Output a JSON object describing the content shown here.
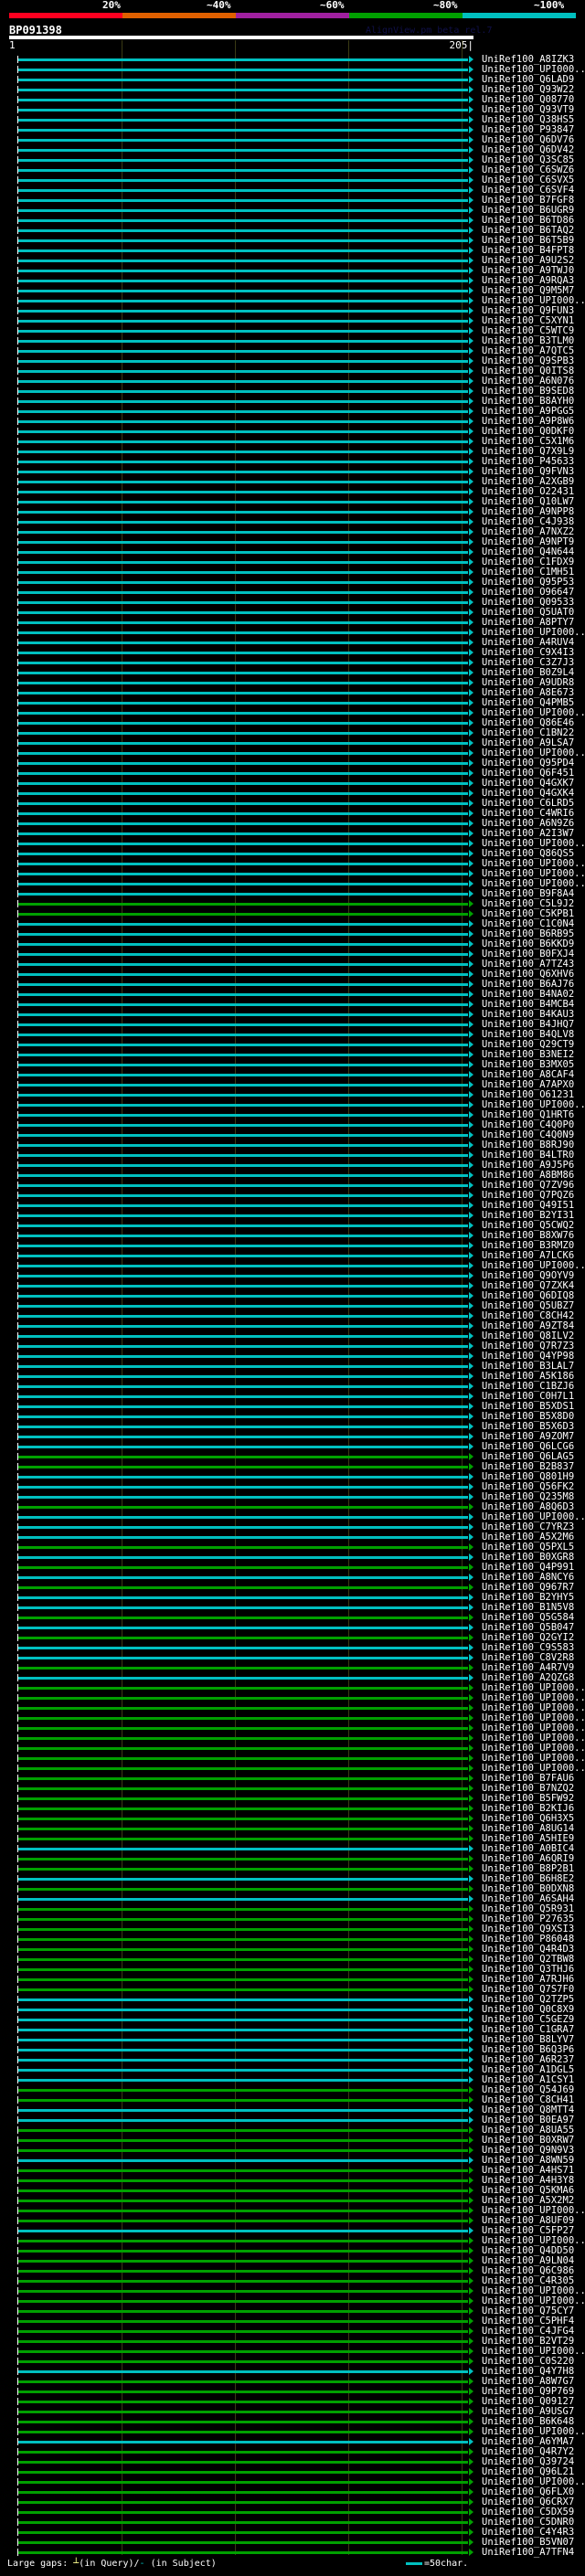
{
  "scale": {
    "labels": [
      "20%",
      "~40%",
      "~60%",
      "~80%",
      "~100%"
    ],
    "colors": [
      "#ff0020",
      "#e06000",
      "#a020a0",
      "#00a000",
      "#00c0c0"
    ]
  },
  "query": {
    "title": "BP091398",
    "start": "1",
    "end": "205|",
    "credit": "AlignView.pm beta rel.7"
  },
  "colors": {
    "c": "#00c0c0",
    "g": "#00a000"
  },
  "rows": [
    [
      "UniRef100_A8IZK3",
      "c"
    ],
    [
      "UniRef100_UPI000..",
      "c"
    ],
    [
      "UniRef100_Q6LAD9",
      "c"
    ],
    [
      "UniRef100_Q93W22",
      "c"
    ],
    [
      "UniRef100_Q08770",
      "c"
    ],
    [
      "UniRef100_Q93VT9",
      "c"
    ],
    [
      "UniRef100_Q38HS5",
      "c"
    ],
    [
      "UniRef100_P93847",
      "c"
    ],
    [
      "UniRef100_Q6DV76",
      "c"
    ],
    [
      "UniRef100_Q6DV42",
      "c"
    ],
    [
      "UniRef100_Q3SC85",
      "c"
    ],
    [
      "UniRef100_C6SWZ6",
      "c"
    ],
    [
      "UniRef100_C6SVX5",
      "c"
    ],
    [
      "UniRef100_C6SVF4",
      "c"
    ],
    [
      "UniRef100_B7FGF8",
      "c"
    ],
    [
      "UniRef100_B6UGR9",
      "c"
    ],
    [
      "UniRef100_B6TD86",
      "c"
    ],
    [
      "UniRef100_B6TAQ2",
      "c"
    ],
    [
      "UniRef100_B6T5B9",
      "c"
    ],
    [
      "UniRef100_B4FPT8",
      "c"
    ],
    [
      "UniRef100_A9U2S2",
      "c"
    ],
    [
      "UniRef100_A9TWJ0",
      "c"
    ],
    [
      "UniRef100_A9RQA3",
      "c"
    ],
    [
      "UniRef100_Q9M5M7",
      "c"
    ],
    [
      "UniRef100_UPI000..",
      "c"
    ],
    [
      "UniRef100_Q9FUN3",
      "c"
    ],
    [
      "UniRef100_C5XYN1",
      "c"
    ],
    [
      "UniRef100_C5WTC9",
      "c"
    ],
    [
      "UniRef100_B3TLM0",
      "c"
    ],
    [
      "UniRef100_A7QTC5",
      "c"
    ],
    [
      "UniRef100_Q9SPB3",
      "c"
    ],
    [
      "UniRef100_Q0ITS8",
      "c"
    ],
    [
      "UniRef100_A6N076",
      "c"
    ],
    [
      "UniRef100_B9SED8",
      "c"
    ],
    [
      "UniRef100_B8AYH0",
      "c"
    ],
    [
      "UniRef100_A9PGG5",
      "c"
    ],
    [
      "UniRef100_A9P8W6",
      "c"
    ],
    [
      "UniRef100_Q0DKF0",
      "c"
    ],
    [
      "UniRef100_C5X1M6",
      "c"
    ],
    [
      "UniRef100_Q7X9L9",
      "c"
    ],
    [
      "UniRef100_P45633",
      "c"
    ],
    [
      "UniRef100_Q9FVN3",
      "c"
    ],
    [
      "UniRef100_A2XGB9",
      "c"
    ],
    [
      "UniRef100_O22431",
      "c"
    ],
    [
      "UniRef100_Q10LW7",
      "c"
    ],
    [
      "UniRef100_A9NPP8",
      "c"
    ],
    [
      "UniRef100_C4J938",
      "c"
    ],
    [
      "UniRef100_A7NXZ2",
      "c"
    ],
    [
      "UniRef100_A9NPT9",
      "c"
    ],
    [
      "UniRef100_Q4N644",
      "c"
    ],
    [
      "UniRef100_C1FDX9",
      "c"
    ],
    [
      "UniRef100_C1MH51",
      "c"
    ],
    [
      "UniRef100_Q95P53",
      "c"
    ],
    [
      "UniRef100_O96647",
      "c"
    ],
    [
      "UniRef100_Q09533",
      "c"
    ],
    [
      "UniRef100_Q5UAT0",
      "c"
    ],
    [
      "UniRef100_A8PTY7",
      "c"
    ],
    [
      "UniRef100_UPI000..",
      "c"
    ],
    [
      "UniRef100_A4RUV4",
      "c"
    ],
    [
      "UniRef100_C9X4I3",
      "c"
    ],
    [
      "UniRef100_C3Z7J3",
      "c"
    ],
    [
      "UniRef100_B0Z9L4",
      "c"
    ],
    [
      "UniRef100_A9UDR8",
      "c"
    ],
    [
      "UniRef100_A8E673",
      "c"
    ],
    [
      "UniRef100_Q4PMB5",
      "c"
    ],
    [
      "UniRef100_UPI000..",
      "c"
    ],
    [
      "UniRef100_Q86E46",
      "c"
    ],
    [
      "UniRef100_C1BN22",
      "c"
    ],
    [
      "UniRef100_A9LSA7",
      "c"
    ],
    [
      "UniRef100_UPI000..",
      "c"
    ],
    [
      "UniRef100_Q95PD4",
      "c"
    ],
    [
      "UniRef100_Q6F451",
      "c"
    ],
    [
      "UniRef100_Q4GXK7",
      "c"
    ],
    [
      "UniRef100_Q4GXK4",
      "c"
    ],
    [
      "UniRef100_C6LRD5",
      "c"
    ],
    [
      "UniRef100_C4WRI6",
      "c"
    ],
    [
      "UniRef100_A6N9Z6",
      "c"
    ],
    [
      "UniRef100_A2I3W7",
      "c"
    ],
    [
      "UniRef100_UPI000..",
      "c"
    ],
    [
      "UniRef100_Q86QS5",
      "c"
    ],
    [
      "UniRef100_UPI000..",
      "c"
    ],
    [
      "UniRef100_UPI000..",
      "c"
    ],
    [
      "UniRef100_UPI000..",
      "c"
    ],
    [
      "UniRef100_B9F8A4",
      "c"
    ],
    [
      "UniRef100_C5L9J2",
      "g"
    ],
    [
      "UniRef100_C5KPB1",
      "g"
    ],
    [
      "UniRef100_C1C0N4",
      "c"
    ],
    [
      "UniRef100_B6RB95",
      "c"
    ],
    [
      "UniRef100_B6KKD9",
      "c"
    ],
    [
      "UniRef100_B0FXJ4",
      "c"
    ],
    [
      "UniRef100_A7TZ43",
      "c"
    ],
    [
      "UniRef100_Q6XHV6",
      "c"
    ],
    [
      "UniRef100_B6AJ76",
      "c"
    ],
    [
      "UniRef100_B4NA02",
      "c"
    ],
    [
      "UniRef100_B4MCB4",
      "c"
    ],
    [
      "UniRef100_B4KAU3",
      "c"
    ],
    [
      "UniRef100_B4JHQ7",
      "c"
    ],
    [
      "UniRef100_B4QLV8",
      "c"
    ],
    [
      "UniRef100_Q29CT9",
      "c"
    ],
    [
      "UniRef100_B3NEI2",
      "c"
    ],
    [
      "UniRef100_B3MX05",
      "c"
    ],
    [
      "UniRef100_A8CAF4",
      "c"
    ],
    [
      "UniRef100_A7APX0",
      "c"
    ],
    [
      "UniRef100_O61231",
      "c"
    ],
    [
      "UniRef100_UPI000..",
      "c"
    ],
    [
      "UniRef100_Q1HRT6",
      "c"
    ],
    [
      "UniRef100_C4Q0P0",
      "c"
    ],
    [
      "UniRef100_C4Q0N9",
      "c"
    ],
    [
      "UniRef100_B8RJ90",
      "c"
    ],
    [
      "UniRef100_B4LTR0",
      "c"
    ],
    [
      "UniRef100_A9J5P6",
      "c"
    ],
    [
      "UniRef100_A8BM86",
      "c"
    ],
    [
      "UniRef100_Q7ZV96",
      "c"
    ],
    [
      "UniRef100_Q7PQZ6",
      "c"
    ],
    [
      "UniRef100_Q49I51",
      "c"
    ],
    [
      "UniRef100_B2YI31",
      "c"
    ],
    [
      "UniRef100_Q5CWQ2",
      "c"
    ],
    [
      "UniRef100_B8XW76",
      "c"
    ],
    [
      "UniRef100_B3RMZ0",
      "c"
    ],
    [
      "UniRef100_A7LCK6",
      "c"
    ],
    [
      "UniRef100_UPI000..",
      "c"
    ],
    [
      "UniRef100_Q9OYV9",
      "c"
    ],
    [
      "UniRef100_Q7ZXK4",
      "c"
    ],
    [
      "UniRef100_Q6DIQ8",
      "c"
    ],
    [
      "UniRef100_Q5UBZ7",
      "c"
    ],
    [
      "UniRef100_C8CH42",
      "c"
    ],
    [
      "UniRef100_A9ZT84",
      "c"
    ],
    [
      "UniRef100_Q8ILV2",
      "c"
    ],
    [
      "UniRef100_Q7R7Z3",
      "c"
    ],
    [
      "UniRef100_Q4YP98",
      "c"
    ],
    [
      "UniRef100_B3LAL7",
      "c"
    ],
    [
      "UniRef100_A5K186",
      "c"
    ],
    [
      "UniRef100_C1BZJ6",
      "c"
    ],
    [
      "UniRef100_C0H7L1",
      "c"
    ],
    [
      "UniRef100_B5XDS1",
      "c"
    ],
    [
      "UniRef100_B5X8D0",
      "c"
    ],
    [
      "UniRef100_B5X6D3",
      "c"
    ],
    [
      "UniRef100_A9ZOM7",
      "c"
    ],
    [
      "UniRef100_Q6LCG6",
      "c"
    ],
    [
      "UniRef100_Q6LAG5",
      "g"
    ],
    [
      "UniRef100_B2B837",
      "g"
    ],
    [
      "UniRef100_Q801H9",
      "c"
    ],
    [
      "UniRef100_Q56FK2",
      "c"
    ],
    [
      "UniRef100_Q235M8",
      "c"
    ],
    [
      "UniRef100_A8Q6D3",
      "g"
    ],
    [
      "UniRef100_UPI000..",
      "c"
    ],
    [
      "UniRef100_C7YRZ3",
      "c"
    ],
    [
      "UniRef100_A5X2M6",
      "c"
    ],
    [
      "UniRef100_Q5PXL5",
      "g"
    ],
    [
      "UniRef100_B0XGR8",
      "c"
    ],
    [
      "UniRef100_Q4P991",
      "g"
    ],
    [
      "UniRef100_A8NCY6",
      "c"
    ],
    [
      "UniRef100_Q967R7",
      "g"
    ],
    [
      "UniRef100_B2YHY5",
      "c"
    ],
    [
      "UniRef100_B1N5V8",
      "c"
    ],
    [
      "UniRef100_Q5G584",
      "g"
    ],
    [
      "UniRef100_Q5B047",
      "c"
    ],
    [
      "UniRef100_Q2GYI2",
      "g"
    ],
    [
      "UniRef100_C9S583",
      "c"
    ],
    [
      "UniRef100_C8V2R8",
      "c"
    ],
    [
      "UniRef100_A4R7V9",
      "g"
    ],
    [
      "UniRef100_A2QZG8",
      "c"
    ],
    [
      "UniRef100_UPI000..",
      "g"
    ],
    [
      "UniRef100_UPI000..",
      "g"
    ],
    [
      "UniRef100_UPI000..",
      "g"
    ],
    [
      "UniRef100_UPI000..",
      "g"
    ],
    [
      "UniRef100_UPI000..",
      "g"
    ],
    [
      "UniRef100_UPI000..",
      "g"
    ],
    [
      "UniRef100_UPI000..",
      "g"
    ],
    [
      "UniRef100_UPI000..",
      "g"
    ],
    [
      "UniRef100_UPI000..",
      "g"
    ],
    [
      "UniRef100_B7FAU6",
      "g"
    ],
    [
      "UniRef100_B7NZQ2",
      "g"
    ],
    [
      "UniRef100_B5FW92",
      "g"
    ],
    [
      "UniRef100_B2KIJ6",
      "g"
    ],
    [
      "UniRef100_Q6H3X5",
      "g"
    ],
    [
      "UniRef100_A8UG14",
      "g"
    ],
    [
      "UniRef100_A5HIE9",
      "g"
    ],
    [
      "UniRef100_A0BIC4",
      "c"
    ],
    [
      "UniRef100_A6QRI9",
      "g"
    ],
    [
      "UniRef100_B8P2B1",
      "g"
    ],
    [
      "UniRef100_B6H8E2",
      "c"
    ],
    [
      "UniRef100_B0DXN8",
      "g"
    ],
    [
      "UniRef100_A6SAH4",
      "c"
    ],
    [
      "UniRef100_Q5R931",
      "g"
    ],
    [
      "UniRef100_P27635",
      "g"
    ],
    [
      "UniRef100_Q9XSI3",
      "g"
    ],
    [
      "UniRef100_P86048",
      "g"
    ],
    [
      "UniRef100_Q4R4D3",
      "g"
    ],
    [
      "UniRef100_Q2TBW8",
      "g"
    ],
    [
      "UniRef100_Q3THJ6",
      "g"
    ],
    [
      "UniRef100_A7RJH6",
      "g"
    ],
    [
      "UniRef100_Q7S7F0",
      "g"
    ],
    [
      "UniRef100_Q2TZP5",
      "c"
    ],
    [
      "UniRef100_Q0C8X9",
      "c"
    ],
    [
      "UniRef100_C5GEZ9",
      "c"
    ],
    [
      "UniRef100_C1GRA7",
      "c"
    ],
    [
      "UniRef100_B8LYV7",
      "c"
    ],
    [
      "UniRef100_B6Q3P6",
      "c"
    ],
    [
      "UniRef100_A6R237",
      "c"
    ],
    [
      "UniRef100_A1DGL5",
      "c"
    ],
    [
      "UniRef100_A1CSY1",
      "c"
    ],
    [
      "UniRef100_Q54J69",
      "g"
    ],
    [
      "UniRef100_C8CH41",
      "g"
    ],
    [
      "UniRef100_Q8MTT4",
      "c"
    ],
    [
      "UniRef100_B0EA97",
      "c"
    ],
    [
      "UniRef100_A8UA55",
      "g"
    ],
    [
      "UniRef100_B0XRW7",
      "g"
    ],
    [
      "UniRef100_Q9N9V3",
      "g"
    ],
    [
      "UniRef100_A8WN59",
      "c"
    ],
    [
      "UniRef100_A4HS71",
      "g"
    ],
    [
      "UniRef100_A4H3Y8",
      "g"
    ],
    [
      "UniRef100_Q5KMA6",
      "g"
    ],
    [
      "UniRef100_A5X2M2",
      "g"
    ],
    [
      "UniRef100_UPI000..",
      "g"
    ],
    [
      "UniRef100_A8UF09",
      "g"
    ],
    [
      "UniRef100_C5FP27",
      "c"
    ],
    [
      "UniRef100_UPI000..",
      "g"
    ],
    [
      "UniRef100_Q4DD50",
      "g"
    ],
    [
      "UniRef100_A9LN04",
      "g"
    ],
    [
      "UniRef100_Q6C986",
      "g"
    ],
    [
      "UniRef100_C4R305",
      "g"
    ],
    [
      "UniRef100_UPI000..",
      "g"
    ],
    [
      "UniRef100_UPI000..",
      "g"
    ],
    [
      "UniRef100_Q75CY7",
      "g"
    ],
    [
      "UniRef100_C5PHF4",
      "g"
    ],
    [
      "UniRef100_C4JFG4",
      "g"
    ],
    [
      "UniRef100_B2VT29",
      "g"
    ],
    [
      "UniRef100_UPI000..",
      "g"
    ],
    [
      "UniRef100_C0S220",
      "g"
    ],
    [
      "UniRef100_Q4Y7H8",
      "c"
    ],
    [
      "UniRef100_A8W7G7",
      "g"
    ],
    [
      "UniRef100_Q9P769",
      "g"
    ],
    [
      "UniRef100_Q09127",
      "g"
    ],
    [
      "UniRef100_A9USG7",
      "g"
    ],
    [
      "UniRef100_B6K648",
      "g"
    ],
    [
      "UniRef100_UPI000..",
      "g"
    ],
    [
      "UniRef100_A6YMA7",
      "c"
    ],
    [
      "UniRef100_Q4R7Y2",
      "g"
    ],
    [
      "UniRef100_Q39724",
      "g"
    ],
    [
      "UniRef100_Q96L21",
      "g"
    ],
    [
      "UniRef100_UPI000..",
      "g"
    ],
    [
      "UniRef100_Q6FLX0",
      "g"
    ],
    [
      "UniRef100_Q6CRX7",
      "g"
    ],
    [
      "UniRef100_C5DX59",
      "g"
    ],
    [
      "UniRef100_C5DNR0",
      "g"
    ],
    [
      "UniRef100_C4Y4R3",
      "g"
    ],
    [
      "UniRef100_B5VN07",
      "g"
    ],
    [
      "UniRef100_A7TFN4",
      "g"
    ]
  ],
  "footer": {
    "gaps_label": "Large gaps:",
    "query_mark": "┴",
    "query_text": "(in Query)/",
    "subject_mark": "-",
    "subject_text": " (in Subject)",
    "legend_text": "=50char."
  }
}
